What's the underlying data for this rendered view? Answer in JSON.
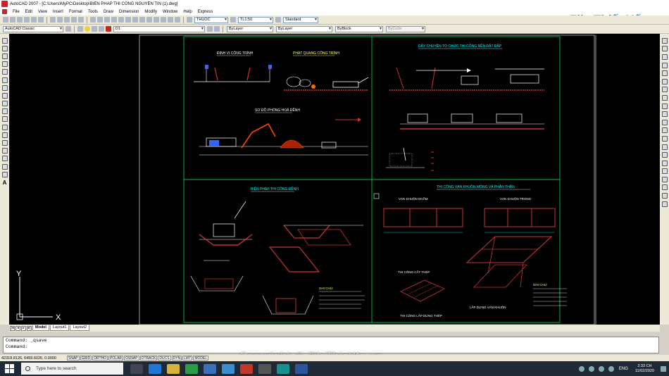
{
  "window": {
    "title": "AutoCAD 2007 - [C:\\Users\\MyPC\\Desktop\\BIEN PHAP THI CONG NGUYEN TIN (1).dwg]"
  },
  "menu": [
    "File",
    "Edit",
    "View",
    "Insert",
    "Format",
    "Tools",
    "Draw",
    "Dimension",
    "Modify",
    "Window",
    "Help",
    "Express"
  ],
  "toolbar": {
    "text_style": "THUOC",
    "dim_style": "TL1:50",
    "table_style": "Standard",
    "workspace": "AutoCAD Classic",
    "layer": "D1",
    "color": "ByLayer",
    "linetype": "ByLayer",
    "lineweight": "ByBlock",
    "plot_style": "ByColor"
  },
  "brand": {
    "name": "File Thiết Kế.vn"
  },
  "drawing": {
    "titles": {
      "dinh_vi": "ĐỊNH VỊ CÔNG TRÌNH",
      "phat_quang": "PHÁT QUANG CÔNG TRÌNH",
      "so_do_phong_hoa": "SƠ ĐỒ PHÓNG HOẢ ĐỀNH",
      "day_chuyen": "DÂY CHUYỀN TỔ CHỨC THI CÔNG NỀN ĐẮT ĐẮP",
      "bien_phap_dao": "BIỆN PHÁP THI CÔNG ĐỀNH",
      "thi_cong_van_khuon": "THI CÔNG VÁN KHUÔN MÓNG VÀ PHẦN THÂN",
      "van_khuon_ngam": "VÁN KHUÔN NGẦM",
      "van_khuon_trong": "VÁN KHUÔN TRONG",
      "thi_cong_cat_thep": "THI CÔNG CẮT THÉP",
      "lap_dung_van_khuon": "LẮP DỰNG VÁN KHUÔN",
      "thi_cong_lap_dung_thep": "THI CÔNG LẮP DỰNG THÉP",
      "ghi_chu": "GHI CHÚ:",
      "ghi_chu_2": "GHI CHÚ:"
    }
  },
  "tabs": {
    "model": "Model",
    "layout1": "Layout1",
    "layout2": "Layout2"
  },
  "command": {
    "line1": "Command: _qsave",
    "line2": "Command:"
  },
  "status": {
    "coords": "42318.8126, 6459.6026, 0.0000",
    "buttons": [
      "SNAP",
      "GRID",
      "ORTHO",
      "POLAR",
      "OSNAP",
      "OTRACK",
      "DUCS",
      "DYN",
      "LWT",
      "MODEL"
    ]
  },
  "taskbar": {
    "search_placeholder": "Type here to search",
    "language": "ENG",
    "time": "2:33 CH",
    "date": "11/02/2020"
  },
  "watermark": "Copyright © FileThietKe.vn",
  "ucs": {
    "x_label": "X",
    "y_label": "Y"
  }
}
